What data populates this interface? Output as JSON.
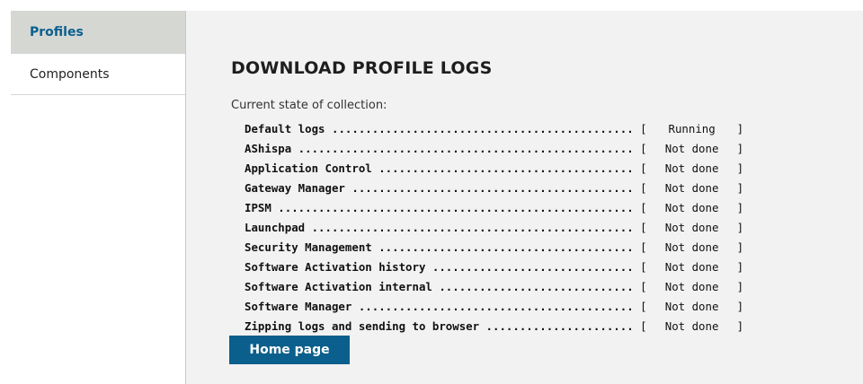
{
  "sidebar": {
    "items": [
      {
        "label": "Profiles",
        "active": true
      },
      {
        "label": "Components",
        "active": false
      }
    ]
  },
  "main": {
    "title": "DOWNLOAD PROFILE LOGS",
    "state_label": "Current state of collection:",
    "logs": [
      {
        "name": "Default logs",
        "dots": " .............................................",
        "status": "Running"
      },
      {
        "name": "AShispa",
        "dots": " ..................................................",
        "status": "Not done"
      },
      {
        "name": "Application Control",
        "dots": " ......................................",
        "status": "Not done"
      },
      {
        "name": "Gateway Manager",
        "dots": " ..........................................",
        "status": "Not done"
      },
      {
        "name": "IPSM",
        "dots": " .....................................................",
        "status": "Not done"
      },
      {
        "name": "Launchpad",
        "dots": " ................................................",
        "status": "Not done"
      },
      {
        "name": "Security Management",
        "dots": " ......................................",
        "status": "Not done"
      },
      {
        "name": "Software Activation history",
        "dots": " ..............................",
        "status": "Not done"
      },
      {
        "name": "Software Activation internal",
        "dots": " .............................",
        "status": "Not done"
      },
      {
        "name": "Software Manager",
        "dots": " .........................................",
        "status": "Not done"
      },
      {
        "name": "Zipping logs and sending to browser",
        "dots": " ......................",
        "status": "Not done"
      }
    ],
    "home_button_label": "Home page"
  },
  "colors": {
    "accent": "#0b5f8c",
    "sidebar_active_bg": "#d5d7d3",
    "main_bg": "#f2f2f2"
  }
}
